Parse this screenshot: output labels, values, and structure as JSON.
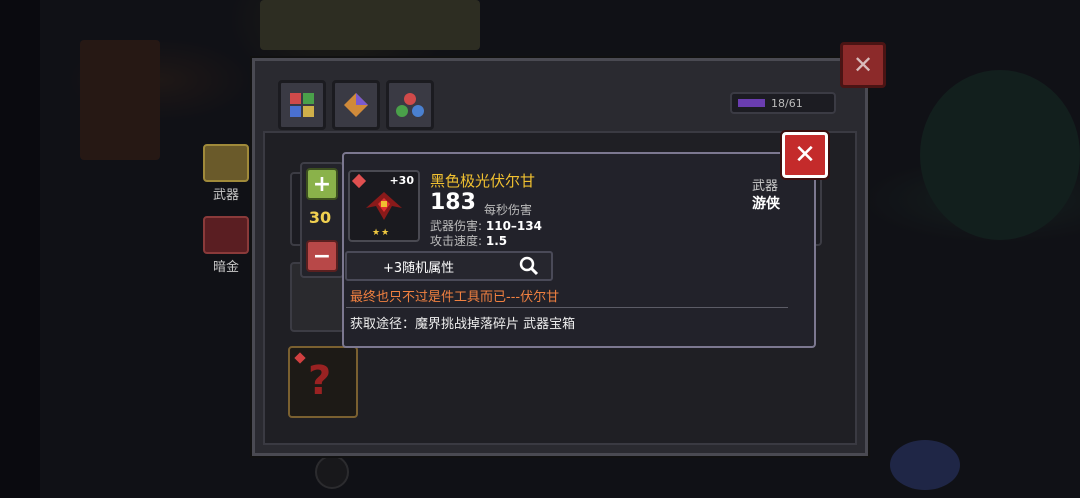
{
  "counter": {
    "text": "18/61",
    "fill_fraction": 0.3
  },
  "side_categories": [
    {
      "label": "武器"
    },
    {
      "label": "暗金"
    }
  ],
  "amount": {
    "value": "30",
    "plus_label": "+",
    "minus_label": "−"
  },
  "weapon": {
    "name": "黑色极光伏尔甘",
    "level": "+30",
    "stars": "★★",
    "dps": "183",
    "dps_label": "每秒伤害",
    "damage_label": "武器伤害:",
    "damage": "110–134",
    "speed_label": "攻击速度:",
    "speed": "1.5",
    "type": "武器",
    "class": "游侠",
    "random_attributes": "+3随机属性",
    "quote": "最终也只不过是件工具而已---伏尔甘",
    "source": "获取途径：魔界挑战掉落碎片 武器宝箱"
  },
  "buttons": {
    "close_label": "✕"
  },
  "colors": {
    "name": "#f0c030",
    "quote": "#f08040",
    "close_red": "#c42b2b",
    "plus_green": "#8ab24a",
    "minus_red": "#b84848",
    "progress_purple": "#6a3db0"
  },
  "icons": [
    "close-icon",
    "plus-icon",
    "minus-icon",
    "magnifier-icon",
    "gem-icon",
    "question-mark-icon"
  ]
}
